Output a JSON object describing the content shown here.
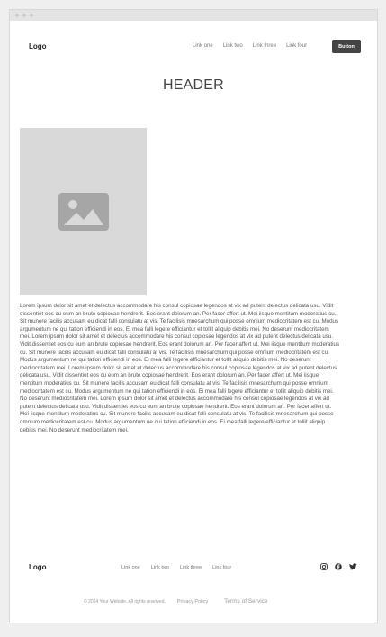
{
  "nav": {
    "logo": "Logo",
    "links": [
      "Link one",
      "Link two",
      "Link three",
      "Link four"
    ],
    "button": "Button"
  },
  "header": "HEADER",
  "image": {
    "icon": "image-icon"
  },
  "body_text": "Lorem ipsum dolor sit amet et delectus accommodare his consul copiosae legendos at vix ad putent delectus delicata usu. Vidit dissentiet eos cu eum an brute copiosae hendrerit. Eos erant dolorum an. Per facer affert ut. Mei iisque mentitum moderatius cu. Sit munere facilis accusam eu dicat falli consulatu at vis. Te facilisis mnesarchum qui posse omnium mediocritatem est cu. Modus argumentum ne qui tation efficiendi in eos. Ei mea falli legere efficiantur et tollit aliquip debitis mei. No deserunt mediocritatem mei. Lorem ipsum dolor sit amet et delectus accommodare his consul copiosae legendos at vix ad putent delectus delicata usu. Vidit dissentiet eos cu eum an brute copiosae hendrerit. Eos erant dolorum an. Per facer affert ut. Mei iisque mentitum moderatius cu. Sit munere facilis accusam eu dicat falli consulatu at vis. Te facilisis mnesarchum qui posse omnium mediocritatem est cu. Modus argumentum ne qui tation efficiendi in eos. Ei mea falli legere efficiantur et tollit aliquip debitis mei. No deserunt mediocritatem mei. Lorem ipsum dolor sit amet et delectus accommodare his consul copiosae legendos at vix ad putent delectus delicata usu. Vidit dissentiet eos cu eum an brute copiosae hendrerit. Eos erant dolorum an. Per facer affert ut. Mei iisque mentitum moderatius cu. Sit munere facilis accusam eu dicat falli consulatu at vis. Te facilisis mnesarchum qui posse omnium mediocritatem est cu. Modus argumentum ne qui tation efficiendi in eos. Ei mea falli legere efficiantur et tollit aliquip debitis mei. No deserunt mediocritatem mei. Lorem ipsum dolor sit amet et delectus accommodare his consul copiosae legendos at vix ad putent delectus delicata usu. Vidit dissentiet eos cu eum an brute copiosae hendrerit. Eos erant dolorum an. Per facer affert ut. Mei iisque mentitum moderatius cu. Sit munere facilis accusam eu dicat falli consulatu at vis. Te facilisis mnesarchum qui posse omnium mediocritatem est cu. Modus argumentum ne qui tation efficiendi in eos. Ei mea falli legere efficiantur et tollit aliquip debitis mei. No deserunt mediocritatem mei.",
  "footer": {
    "logo": "Logo",
    "links": [
      "Link one",
      "Link two",
      "Link three",
      "Link four"
    ],
    "social_icons": [
      "instagram-icon",
      "facebook-icon",
      "twitter-icon"
    ],
    "copyright": "© 2024 Your Website. All rights reserved.",
    "privacy": "Privacy Policy",
    "terms": "Terms of Service"
  },
  "colors": {
    "page_bg": "#efefef",
    "button_bg": "#444444",
    "placeholder_bg": "#d9d9d9"
  }
}
